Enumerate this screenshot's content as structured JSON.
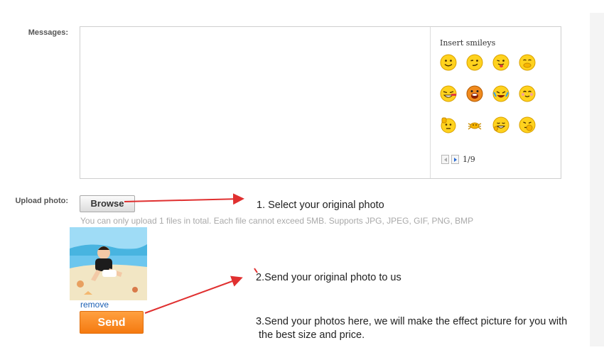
{
  "form": {
    "messages_label": "Messages:",
    "upload_label": "Upload photo:",
    "browse_label": "Browse",
    "upload_hint": "You can only upload 1 files in total. Each file cannot exceed 5MB. Supports JPG, JPEG, GIF, PNG, BMP",
    "remove_label": "remove",
    "send_label": "Send"
  },
  "smileys": {
    "title": "Insert smileys",
    "page": "1/9",
    "icons": [
      "smile-icon",
      "wink-icon",
      "tongue-icon",
      "cover-mouth-icon",
      "laugh-tears-icon",
      "pig-face-icon",
      "crying-laugh-icon",
      "blush-hands-icon",
      "head-scratch-icon",
      "crab-icon",
      "grin-icon",
      "thinking-icon"
    ]
  },
  "instructions": {
    "step1": "1. Select your original photo",
    "step2": "2.Send your original photo to us",
    "step3_line1": "3.Send your photos here, we will make the effect picture for you with",
    "step3_line2": "the best size and price."
  },
  "colors": {
    "send_button": "#f57a10",
    "arrow": "#e03030",
    "remove_link": "#1a5fb4",
    "hint_text": "#a9a9a9"
  }
}
